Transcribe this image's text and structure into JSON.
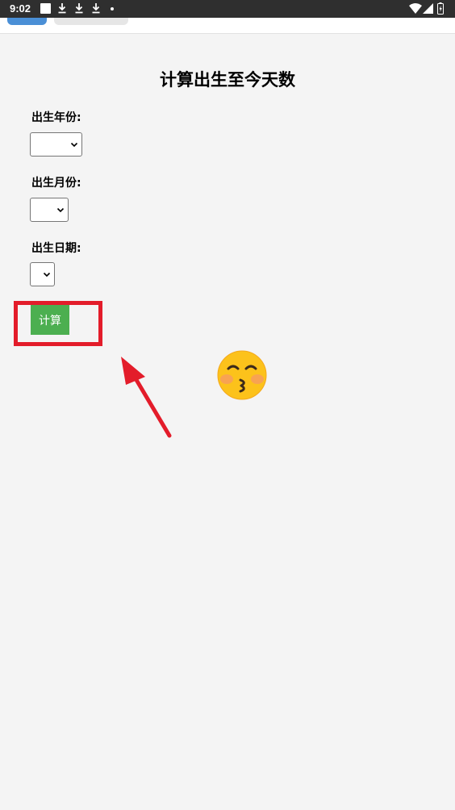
{
  "status_bar": {
    "time": "9:02",
    "left_icons": [
      "square-notification-icon",
      "download-icon",
      "download-icon",
      "download-icon",
      "dot-icon"
    ],
    "right_icons": [
      "wifi-icon",
      "signal-icon",
      "battery-icon"
    ]
  },
  "page": {
    "title": "计算出生至今天数"
  },
  "form": {
    "year_label": "出生年份:",
    "year_value": "",
    "month_label": "出生月份:",
    "month_value": "",
    "day_label": "出生日期:",
    "day_value": "",
    "submit_label": "计算"
  },
  "colors": {
    "button_green": "#4caf50",
    "annotation_red": "#e31c2a",
    "tab_blue": "#4a8fd6"
  },
  "decorations": {
    "emoji": "kissing-face-icon",
    "annotation": "red-arrow-icon"
  }
}
